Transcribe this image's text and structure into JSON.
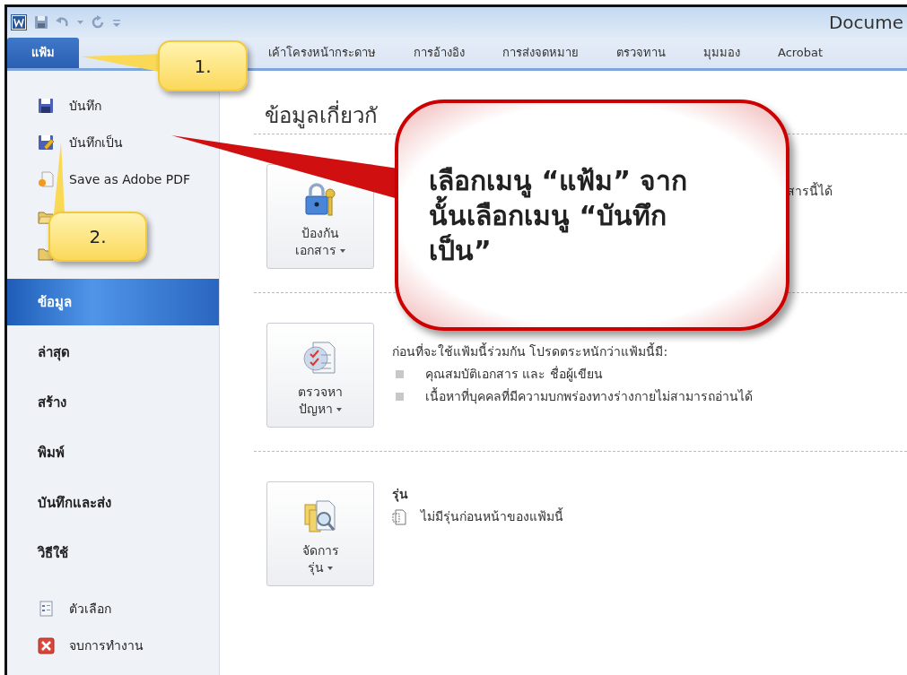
{
  "window": {
    "title": "Docume"
  },
  "ribbon_tabs": [
    {
      "label": "แฟ้ม",
      "selected": true
    },
    {
      "label": "เค้าโครงหน้ากระดาษ",
      "selected": false
    },
    {
      "label": "การอ้างอิง",
      "selected": false
    },
    {
      "label": "การส่งจดหมาย",
      "selected": false
    },
    {
      "label": "ตรวจทาน",
      "selected": false
    },
    {
      "label": "มุมมอง",
      "selected": false
    },
    {
      "label": "Acrobat",
      "selected": false
    }
  ],
  "backstage_menu": [
    {
      "kind": "command",
      "label": "บันทึก"
    },
    {
      "kind": "command",
      "label": "บันทึกเป็น"
    },
    {
      "kind": "command",
      "label": "Save as Adobe PDF"
    },
    {
      "kind": "command"
    },
    {
      "kind": "command"
    },
    {
      "kind": "page",
      "label": "ข้อมูล",
      "selected": true
    },
    {
      "kind": "page",
      "label": "ล่าสุด",
      "selected": false
    },
    {
      "kind": "page",
      "label": "สร้าง",
      "selected": false
    },
    {
      "kind": "page",
      "label": "พิมพ์",
      "selected": false
    },
    {
      "kind": "page",
      "label": "บันทึกและส่ง",
      "selected": false
    },
    {
      "kind": "page",
      "label": "วิธีใช้",
      "selected": false
    },
    {
      "kind": "command",
      "label": "ตัวเลือก"
    },
    {
      "kind": "command",
      "label": "จบการทำงาน"
    }
  ],
  "info": {
    "heading": "ข้อมูลเกี่ยวกั",
    "sections": [
      {
        "button": "ป้องกัน\nเอกสาร",
        "fragment": "สารนี้ได้"
      },
      {
        "button": "ตรวจหา\nปัญหา",
        "intro": "ก่อนที่จะใช้แฟ้มนี้ร่วมกัน โปรดตระหนักว่าแฟ้มนี้มี:",
        "bullets": [
          "คุณสมบัติเอกสาร และ ชื่อผู้เขียน",
          "เนื้อหาที่บุคคลที่มีความบกพร่องทางร่างกายไม่สามารถอ่านได้"
        ]
      },
      {
        "button": "จัดการ\nรุ่น",
        "heading": "รุ่น",
        "items": [
          "ไม่มีรุ่นก่อนหน้าของแฟ้มนี้"
        ]
      }
    ]
  },
  "callouts": [
    {
      "kind": "yellow",
      "text": "1."
    },
    {
      "kind": "yellow",
      "text": "2."
    },
    {
      "kind": "red",
      "text": "เลือกเมนู “แฟ้ม” จากนั้นเลือกเมนู “บันทึกเป็น”"
    }
  ]
}
